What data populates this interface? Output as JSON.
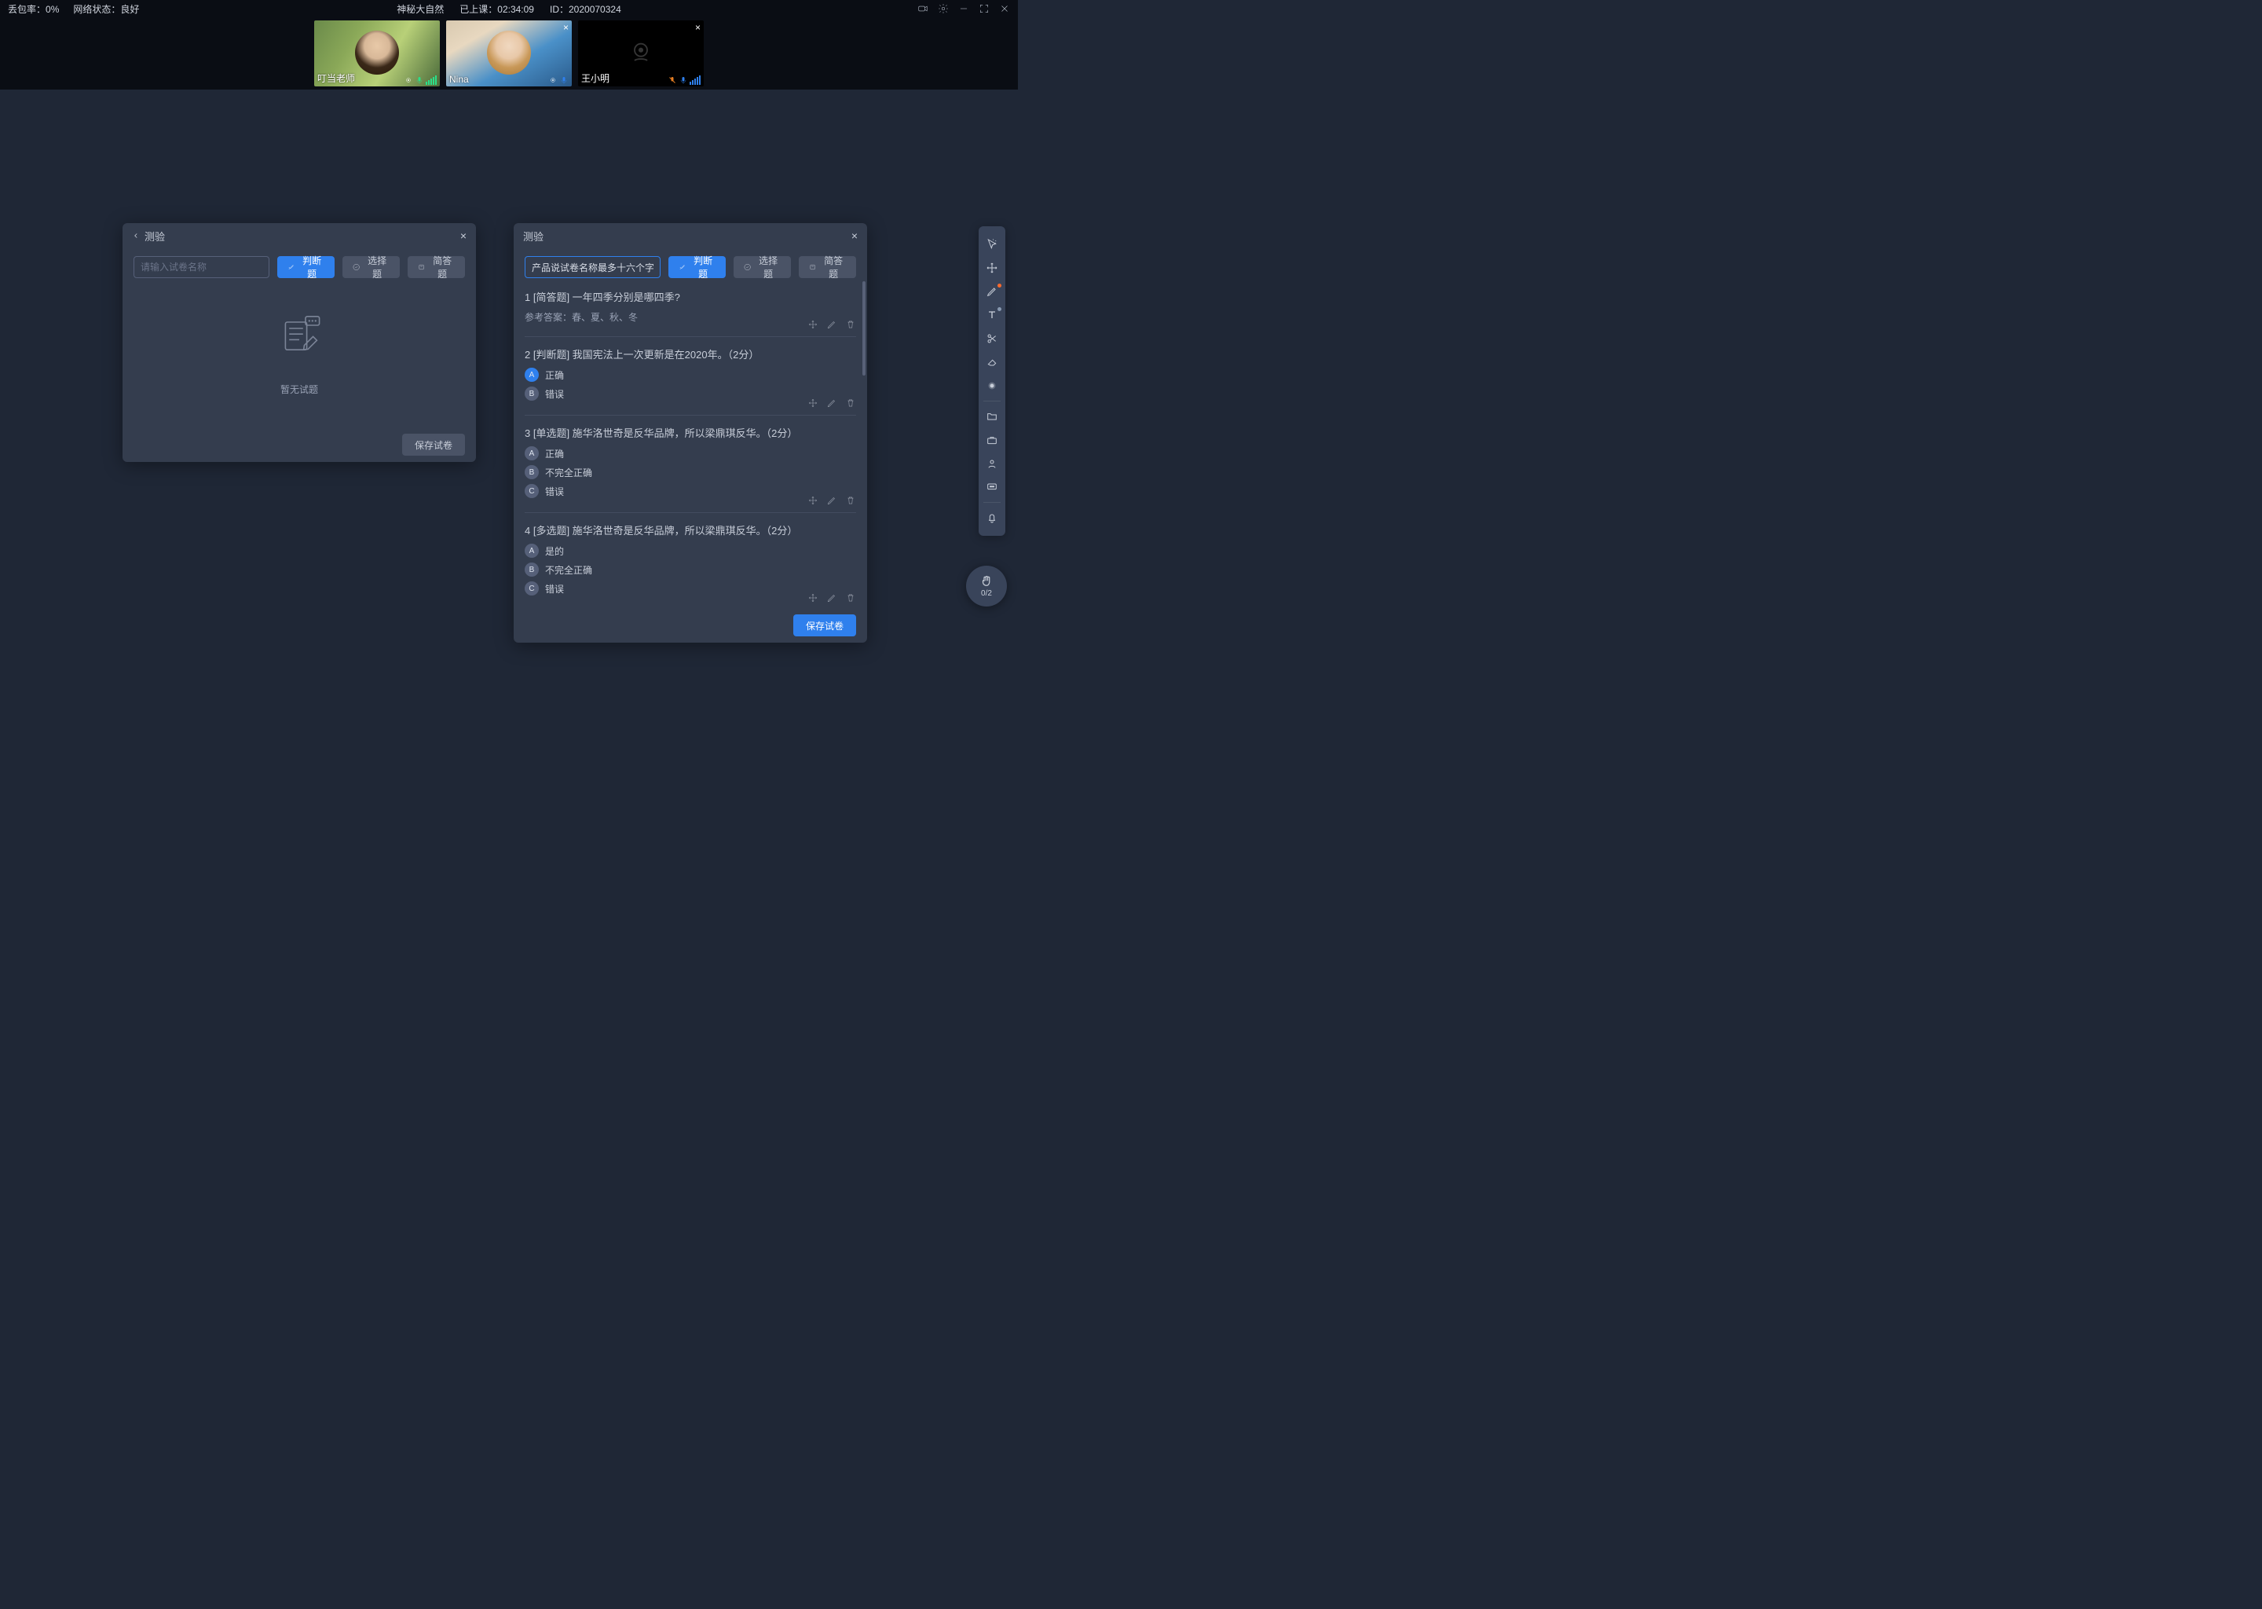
{
  "top": {
    "packet_loss_label": "丢包率：",
    "packet_loss_value": "0%",
    "net_label": "网络状态：",
    "net_value": "良好",
    "course_title": "神秘大自然",
    "time_label": "已上课：",
    "time_value": "02:34:09",
    "id_label": "ID：",
    "id_value": "2020070324"
  },
  "videos": [
    {
      "name": "叮当老师"
    },
    {
      "name": "Nina"
    },
    {
      "name": "王小明"
    }
  ],
  "panel_left": {
    "title": "测验",
    "placeholder": "请输入试卷名称",
    "btn_judge": "判断题",
    "btn_multi": "选择题",
    "btn_short": "简答题",
    "empty_text": "暂无试题",
    "save": "保存试卷"
  },
  "panel_right": {
    "title": "测验",
    "name_value": "产品说试卷名称最多十六个字",
    "btn_judge": "判断题",
    "btn_multi": "选择题",
    "btn_short": "简答题",
    "save": "保存试卷",
    "questions": [
      {
        "title": "1 [简答题] 一年四季分别是哪四季?",
        "answer": "参考答案：春、夏、秋、冬"
      },
      {
        "title": "2 [判断题] 我国宪法上一次更新是在2020年。（2分）",
        "options": [
          {
            "letter": "A",
            "text": "正确",
            "selected": true
          },
          {
            "letter": "B",
            "text": "错误",
            "selected": false
          }
        ]
      },
      {
        "title": "3 [单选题] 施华洛世奇是反华品牌，所以梁鼎琪反华。（2分）",
        "options": [
          {
            "letter": "A",
            "text": "正确",
            "selected": false
          },
          {
            "letter": "B",
            "text": "不完全正确",
            "selected": false
          },
          {
            "letter": "C",
            "text": "错误",
            "selected": false
          }
        ]
      },
      {
        "title": "4 [多选题] 施华洛世奇是反华品牌，所以梁鼎琪反华。（2分）",
        "options": [
          {
            "letter": "A",
            "text": "是的",
            "selected": false
          },
          {
            "letter": "B",
            "text": "不完全正确",
            "selected": false
          },
          {
            "letter": "C",
            "text": "错误",
            "selected": false
          }
        ]
      }
    ]
  },
  "hand": {
    "caption": "0/2"
  }
}
